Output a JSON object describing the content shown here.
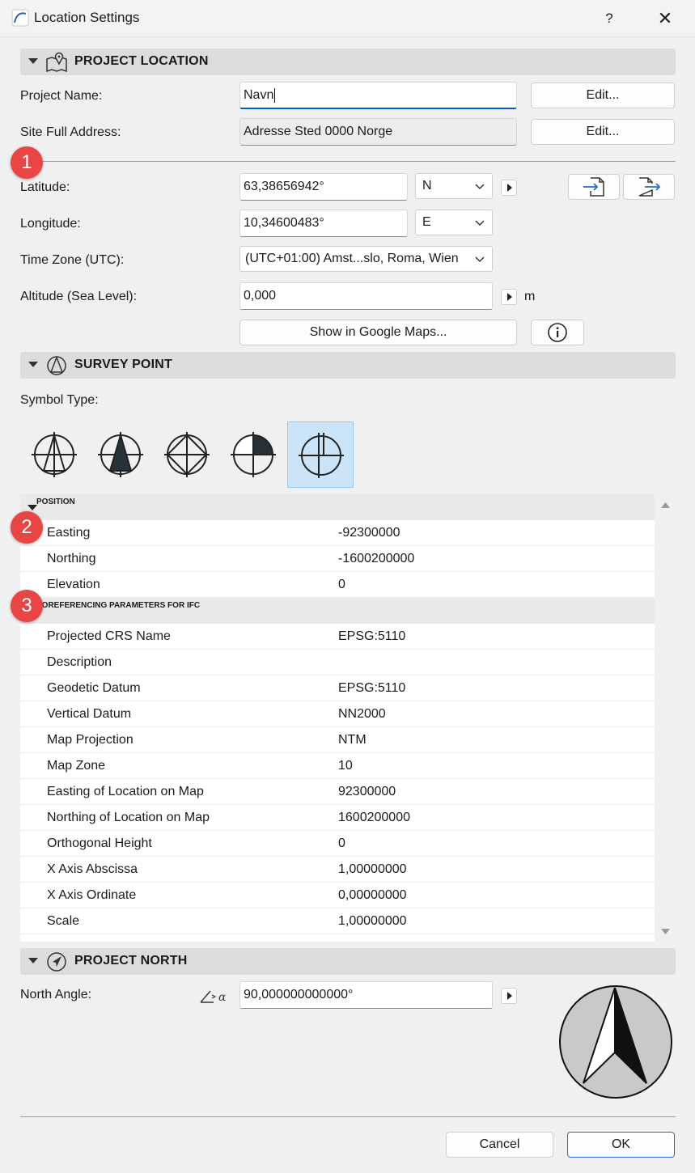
{
  "window": {
    "title": "Location Settings",
    "help": "?",
    "close": "✕"
  },
  "project_location": {
    "title": "PROJECT LOCATION",
    "project_name_label": "Project Name:",
    "project_name_value": "Navn",
    "site_address_label": "Site Full Address:",
    "site_address_value": "Adresse Sted 0000 Norge",
    "edit_label": "Edit...",
    "latitude_label": "Latitude:",
    "latitude_value": "63,38656942°",
    "latitude_dir": "N",
    "longitude_label": "Longitude:",
    "longitude_value": "10,34600483°",
    "longitude_dir": "E",
    "timezone_label": "Time Zone (UTC):",
    "timezone_value": "(UTC+01:00) Amst...slo, Roma, Wien",
    "altitude_label": "Altitude (Sea Level):",
    "altitude_value": "0,000",
    "altitude_unit": "m",
    "google_maps_label": "Show in Google Maps..."
  },
  "survey_point": {
    "title": "SURVEY POINT",
    "symbol_type_label": "Symbol Type:",
    "symbols": [
      "survey-symbol-1",
      "survey-symbol-2",
      "survey-symbol-3",
      "survey-symbol-4",
      "survey-symbol-5"
    ],
    "selected_symbol": 5,
    "position_group": "POSITION",
    "position_rows": [
      {
        "key": "Easting",
        "value": "-92300000"
      },
      {
        "key": "Northing",
        "value": "-1600200000"
      },
      {
        "key": "Elevation",
        "value": "0"
      }
    ],
    "ifc_group": "EOREFERENCING PARAMETERS FOR IFC",
    "ifc_rows": [
      {
        "key": "Projected CRS Name",
        "value": "EPSG:5110"
      },
      {
        "key": "Description",
        "value": ""
      },
      {
        "key": "Geodetic Datum",
        "value": "EPSG:5110"
      },
      {
        "key": "Vertical Datum",
        "value": "NN2000"
      },
      {
        "key": "Map Projection",
        "value": "NTM"
      },
      {
        "key": "Map Zone",
        "value": "10"
      },
      {
        "key": "Easting of Location on Map",
        "value": "92300000"
      },
      {
        "key": "Northing of Location on Map",
        "value": "1600200000"
      },
      {
        "key": "Orthogonal Height",
        "value": "0"
      },
      {
        "key": "X Axis Abscissa",
        "value": "1,00000000"
      },
      {
        "key": "X Axis Ordinate",
        "value": "0,00000000"
      },
      {
        "key": "Scale",
        "value": "1,00000000"
      }
    ]
  },
  "project_north": {
    "title": "PROJECT NORTH",
    "north_angle_label": "North Angle:",
    "north_angle_value": "90,000000000000°"
  },
  "badges": [
    "1",
    "2",
    "3"
  ],
  "footer": {
    "cancel": "Cancel",
    "ok": "OK"
  },
  "colors": {
    "accent": "#005fb8",
    "badge": "#e84545",
    "selected": "#cce4f7"
  }
}
